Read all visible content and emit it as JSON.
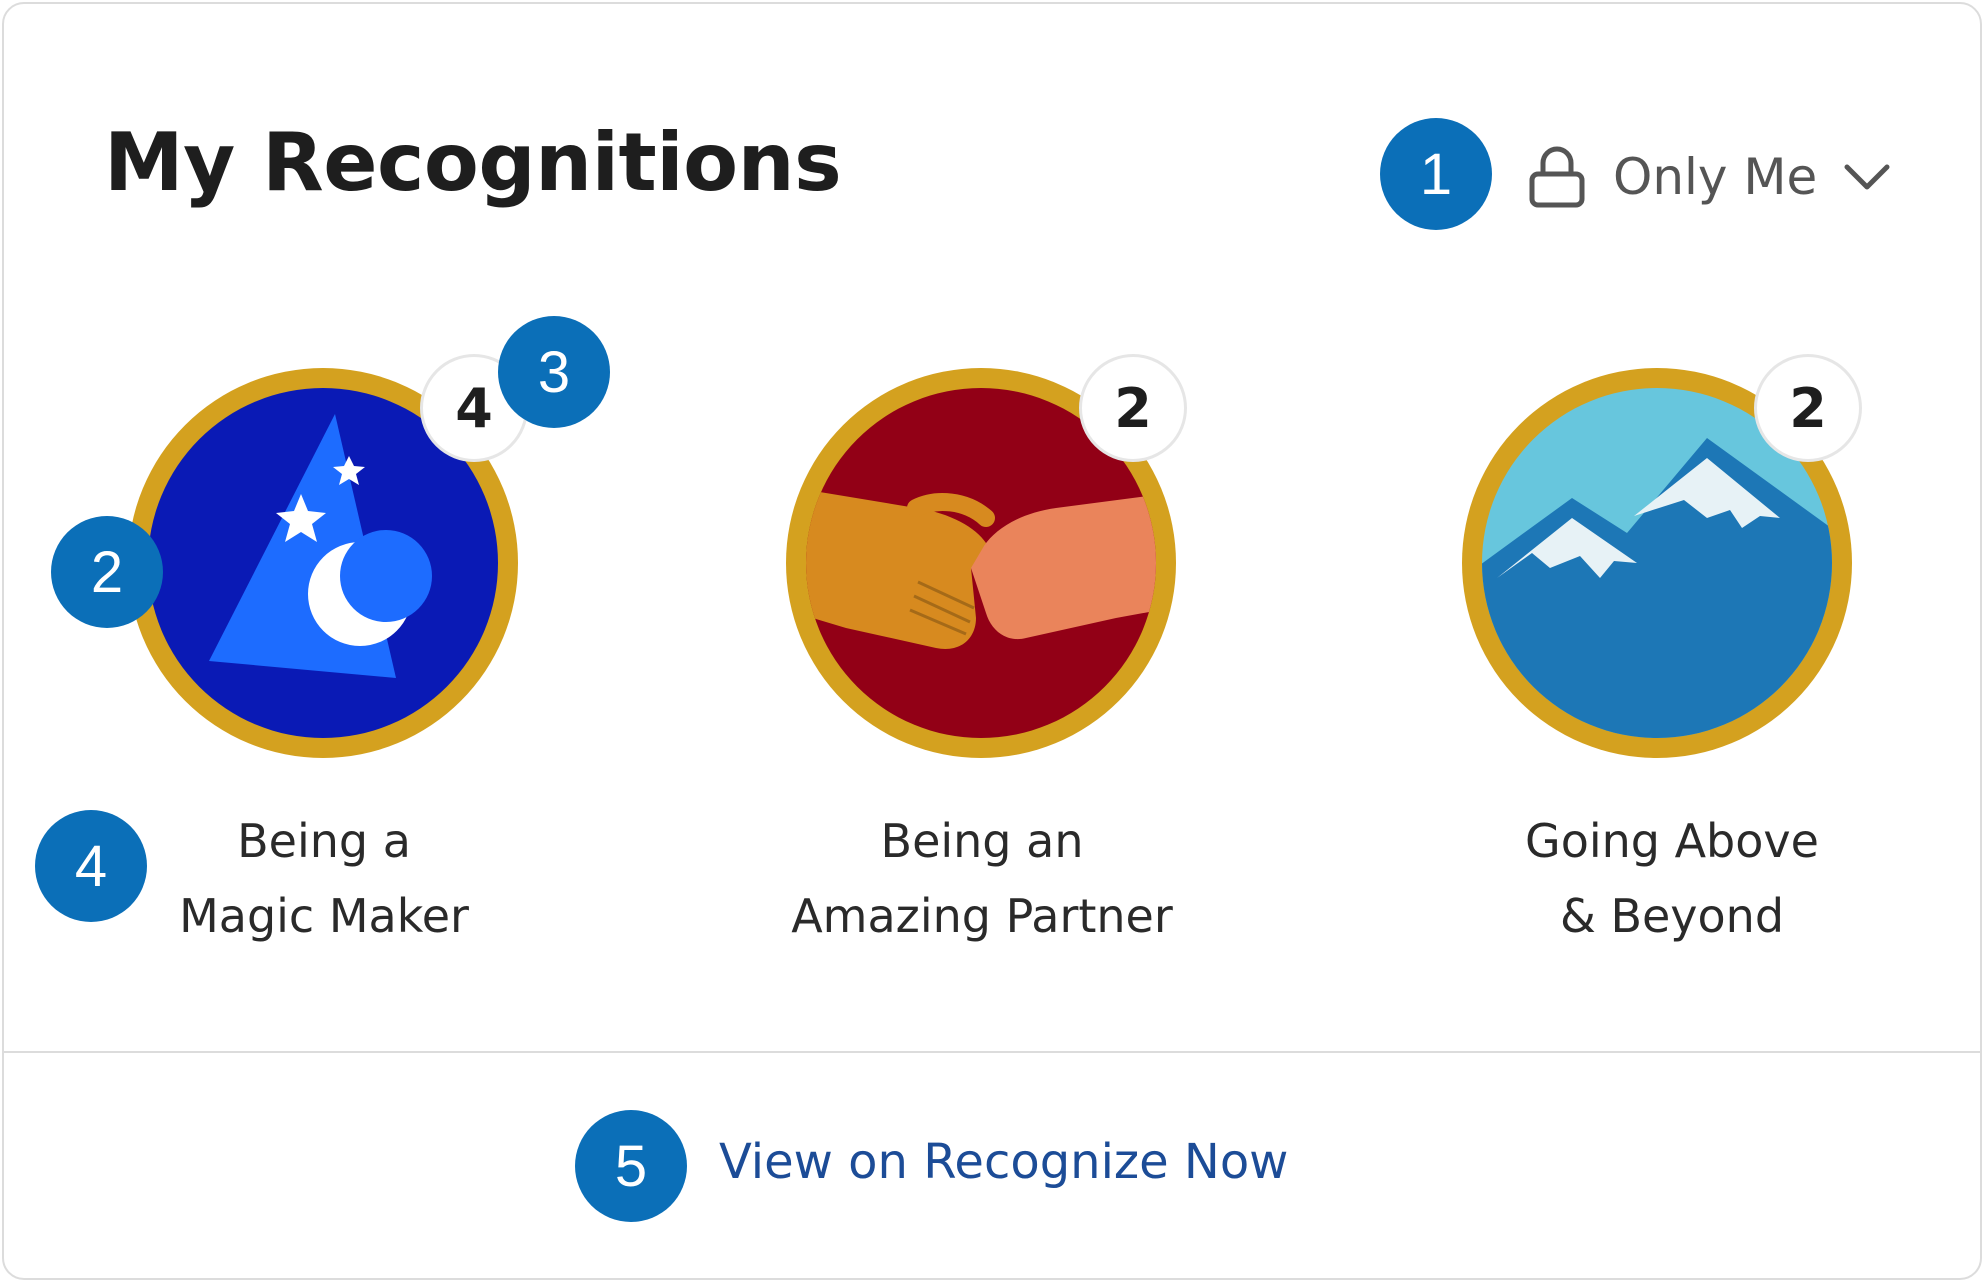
{
  "header": {
    "title": "My Recognitions",
    "privacy": {
      "selected": "Only Me",
      "icon": "lock-icon",
      "dropdown_icon": "chevron-down-icon"
    }
  },
  "recognitions": [
    {
      "line1": "Being a",
      "line2": "Magic Maker",
      "count": "4",
      "icon": "wizard-hat-icon",
      "bg_color": "#0a1ab5"
    },
    {
      "line1": "Being an",
      "line2": "Amazing Partner",
      "count": "2",
      "icon": "handshake-icon",
      "bg_color": "#920016"
    },
    {
      "line1": "Going Above",
      "line2": "& Beyond",
      "count": "2",
      "icon": "mountains-icon",
      "bg_color": "#1d77b6"
    }
  ],
  "footer": {
    "link": "View on Recognize Now"
  },
  "callouts": [
    "1",
    "2",
    "3",
    "4",
    "5"
  ],
  "colors": {
    "badge_ring": "#d4a11f",
    "callout": "#0b6fb8",
    "link": "#1c4c97"
  }
}
